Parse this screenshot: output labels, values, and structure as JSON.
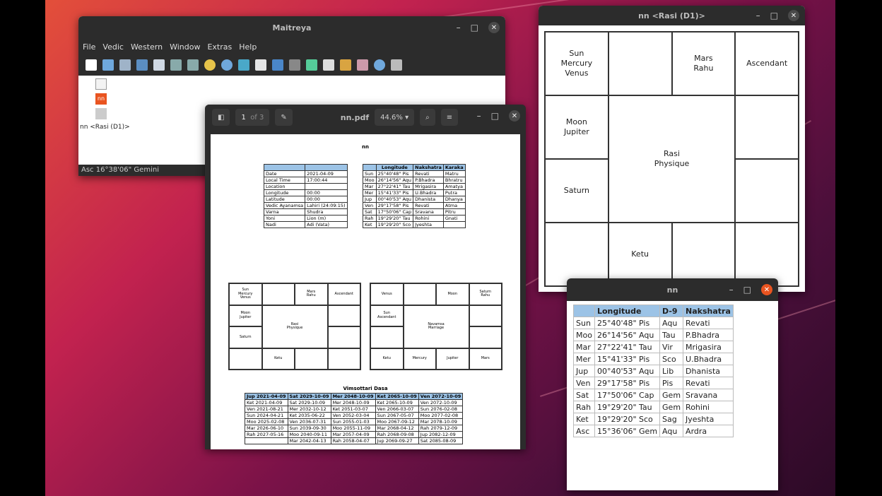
{
  "maitreya": {
    "title": "Maitreya",
    "menu": [
      "File",
      "Vedic",
      "Western",
      "Window",
      "Extras",
      "Help"
    ],
    "doc_label": "nn <Rasi (D1)>",
    "status": "Asc 16°38'06\" Gemini"
  },
  "pdf": {
    "page_num": "1",
    "page_of": "of 3",
    "filename": "nn.pdf",
    "zoom": "44.6%",
    "page_title": "nn",
    "basic": [
      [
        "Date",
        "2021-04-09"
      ],
      [
        "Local Time",
        "17:00:44"
      ],
      [
        "Location",
        ""
      ],
      [
        "Longitude",
        "00:00"
      ],
      [
        "Latitude",
        "00:00"
      ],
      [
        "Vedic Ayanamsa",
        "Lahiri (24:09:15)"
      ],
      [
        "Varna",
        "Shudra"
      ],
      [
        "Yoni",
        "Lion (m)"
      ],
      [
        "Nadi",
        "Adi (Vata)"
      ]
    ],
    "planets_header": [
      "",
      "Longitude",
      "Nakshatra",
      "Karaka"
    ],
    "planets": [
      [
        "Sun",
        "25°40'48\" Pis",
        "Revati",
        "Matru"
      ],
      [
        "Moo",
        "26°14'56\" Aqu",
        "P.Bhadra",
        "Bhratru"
      ],
      [
        "Mar",
        "27°22'41\" Tau",
        "Mrigasira",
        "Amatya"
      ],
      [
        "Mer",
        "15°41'33\" Pis",
        "U.Bhadra",
        "Putra"
      ],
      [
        "Jup",
        "00°40'53\" Aqu",
        "Dhanista",
        "Dhanya"
      ],
      [
        "Ven",
        "29°17'58\" Pis",
        "Revati",
        "Atma"
      ],
      [
        "Sat",
        "17°50'06\" Cap",
        "Sravana",
        "Pitru"
      ],
      [
        "Rah",
        "19°29'20\" Tau",
        "Rohini",
        "Gnati"
      ],
      [
        "Ket",
        "19°29'20\" Sco",
        "Jyeshta",
        ""
      ]
    ],
    "rasi_cells": [
      "Sun\nMercury\nVenus",
      "",
      "Mars\nRahu",
      "Ascendant",
      "Moon\nJupiter",
      "",
      "Saturn",
      "",
      "",
      "Ketu",
      "",
      ""
    ],
    "rasi_center": "Rasi\nPhysique",
    "navamsa_cells": [
      "Venus",
      "",
      "Moon",
      "Saturn\nRahu",
      "Sun\nAscendant",
      "",
      "",
      "",
      "Ketu",
      "Mercury",
      "Jupiter",
      "Mars"
    ],
    "navamsa_center": "Navamsa\nMarriage",
    "dasa_title": "Vimsottari Dasa",
    "dasa_header": [
      "Jup 2021-04-09",
      "Sat 2029-10-09",
      "Mer 2048-10-09",
      "Ket 2065-10-09",
      "Ven 2072-10-09"
    ],
    "dasa_rows": [
      [
        "Ket 2021-04-09",
        "Sat 2029-10-09",
        "Mer 2048-10-09",
        "Ket 2065-10-09",
        "Ven 2072-10-09"
      ],
      [
        "Ven 2021-08-21",
        "Mer 2032-10-12",
        "Ket 2051-03-07",
        "Ven 2066-03-07",
        "Sun 2076-02-08"
      ],
      [
        "Sun 2024-04-21",
        "Ket 2035-06-22",
        "Ven 2052-03-04",
        "Sun 2067-05-07",
        "Moo 2077-02-08"
      ],
      [
        "Moo 2025-02-08",
        "Ven 2036-07-31",
        "Sun 2055-01-03",
        "Moo 2067-09-12",
        "Mar 2078-10-09"
      ],
      [
        "Mar 2026-06-10",
        "Sun 2039-09-30",
        "Moo 2055-11-09",
        "Mar 2068-04-12",
        "Rah 2079-12-09"
      ],
      [
        "Rah 2027-05-16",
        "Moo 2040-09-11",
        "Mar 2057-04-09",
        "Rah 2068-09-08",
        "Jup 2082-12-09"
      ],
      [
        "",
        "Mar 2042-04-13",
        "Rah 2058-04-07",
        "Jup 2069-09-27",
        "Sat 2085-08-09"
      ]
    ]
  },
  "rasi": {
    "title": "nn <Rasi (D1)>",
    "cells": [
      "Sun\nMercury\nVenus",
      "",
      "Mars\nRahu",
      "Ascendant",
      "Moon\nJupiter",
      "",
      "Saturn",
      "",
      "",
      "Ketu",
      "",
      ""
    ],
    "center": "Rasi\nPhysique"
  },
  "nn": {
    "title": "nn",
    "header": [
      "",
      "Longitude",
      "D-9",
      "Nakshatra"
    ],
    "rows": [
      [
        "Sun",
        "25°40'48\" Pis",
        "Aqu",
        "Revati"
      ],
      [
        "Moo",
        "26°14'56\" Aqu",
        "Tau",
        "P.Bhadra"
      ],
      [
        "Mar",
        "27°22'41\" Tau",
        "Vir",
        "Mrigasira"
      ],
      [
        "Mer",
        "15°41'33\" Pis",
        "Sco",
        "U.Bhadra"
      ],
      [
        "Jup",
        "00°40'53\" Aqu",
        "Lib",
        "Dhanista"
      ],
      [
        "Ven",
        "29°17'58\" Pis",
        "Pis",
        "Revati"
      ],
      [
        "Sat",
        "17°50'06\" Cap",
        "Gem",
        "Sravana"
      ],
      [
        "Rah",
        "19°29'20\" Tau",
        "Gem",
        "Rohini"
      ],
      [
        "Ket",
        "19°29'20\" Sco",
        "Sag",
        "Jyeshta"
      ],
      [
        "Asc",
        "15°36'06\" Gem",
        "Aqu",
        "Ardra"
      ]
    ]
  },
  "colors": {
    "accent_orange": "#e95420",
    "table_header": "#9cc3e6",
    "titlebar": "#2c2c2c"
  }
}
